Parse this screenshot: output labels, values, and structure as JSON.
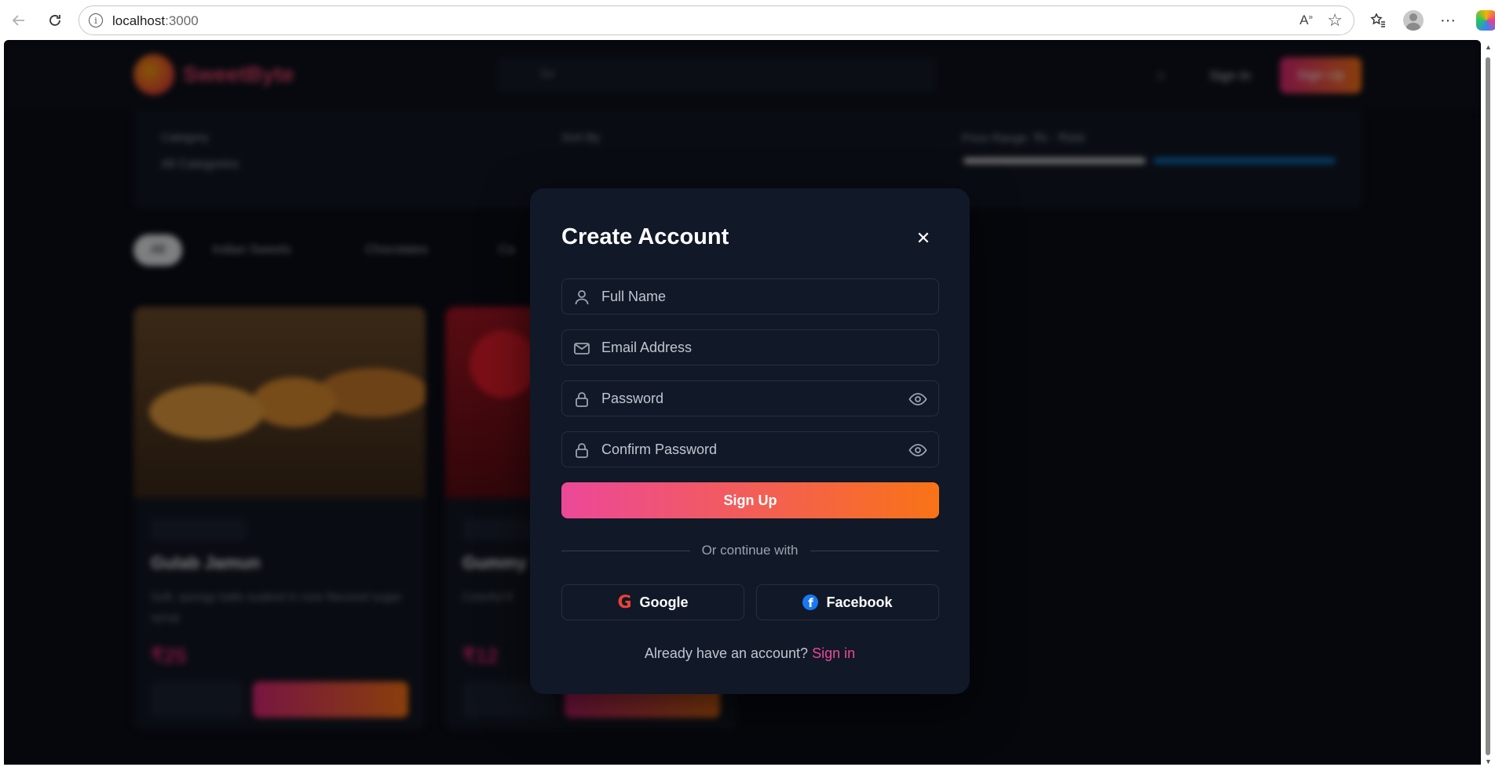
{
  "browser": {
    "url_host": "localhost",
    "url_port": ":3000",
    "back_icon": "arrow-left-icon",
    "reload_icon": "reload-icon"
  },
  "background_page": {
    "brand": "SweetByte",
    "search_placeholder": "Se",
    "nav": {
      "signin": "Sign In",
      "signup": "Sign Up"
    },
    "filters": {
      "category_label": "Category",
      "category_value": "All Categories",
      "sort_label": "Sort By",
      "price_label": "Price Range: ₹0 - ₹500"
    },
    "chips": [
      "All",
      "Indian Sweets",
      "Chocolates",
      "Ca"
    ],
    "products": [
      {
        "name": "Gulab Jamun",
        "desc": "Soft, spongy balls soaked in rose flavored sugar syrup",
        "price": "₹25"
      },
      {
        "name": "Gummy",
        "desc": "Colorful fr",
        "price": "₹12"
      }
    ]
  },
  "modal": {
    "title": "Create Account",
    "fields": {
      "full_name": "Full Name",
      "email": "Email Address",
      "password": "Password",
      "confirm_password": "Confirm Password"
    },
    "signup_label": "Sign Up",
    "divider": "Or continue with",
    "google_label": "Google",
    "facebook_label": "Facebook",
    "footer_text": "Already have an account?",
    "footer_link": "Sign in"
  },
  "colors": {
    "accent_pink": "#ec4899",
    "accent_orange": "#f97316",
    "modal_bg": "#111827"
  }
}
